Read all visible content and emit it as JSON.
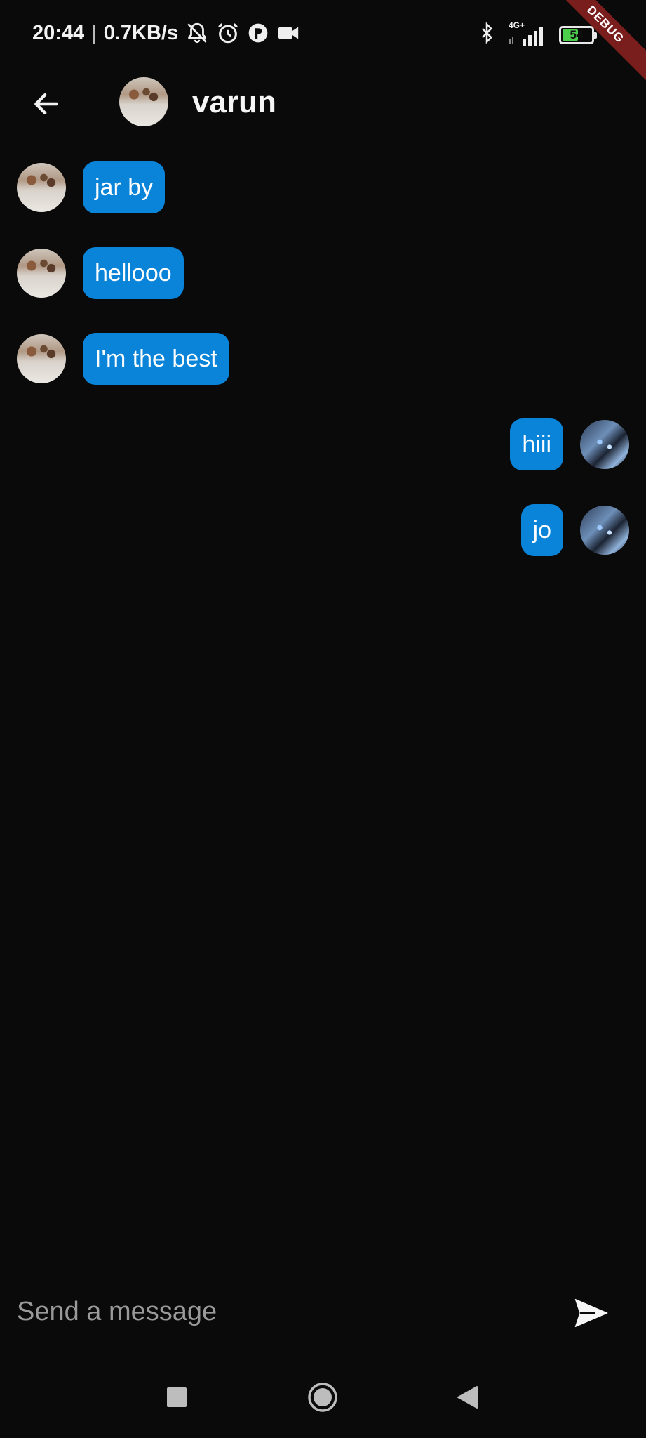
{
  "status_bar": {
    "time": "20:44",
    "separator": "|",
    "network_speed": "0.7KB/s",
    "network_type": "4G+",
    "battery_level": "54",
    "battery_fraction": 0.54,
    "icons": [
      "bell-off-icon",
      "alarm-icon",
      "app-icon",
      "video-icon",
      "bluetooth-icon",
      "signal-icon",
      "battery-icon"
    ]
  },
  "debug_banner": "DEBUG",
  "header": {
    "title": "varun",
    "back_icon": "arrow-left-icon"
  },
  "messages": [
    {
      "text": "jar by",
      "direction": "incoming"
    },
    {
      "text": "hellooo",
      "direction": "incoming"
    },
    {
      "text": "I'm the best",
      "direction": "incoming"
    },
    {
      "text": "hiii",
      "direction": "outgoing"
    },
    {
      "text": "jo",
      "direction": "outgoing"
    }
  ],
  "composer": {
    "placeholder": "Send a message",
    "value": "",
    "send_icon": "send-icon"
  },
  "nav_bar": {
    "icons": [
      "recents-square-icon",
      "home-circle-icon",
      "back-triangle-icon"
    ]
  },
  "colors": {
    "background": "#0a0a0a",
    "bubble": "#0a84d9",
    "text": "#ffffff",
    "placeholder": "#9a9a9a",
    "debug_banner": "#7a1d1d",
    "battery_fill": "#4ccd4c"
  }
}
